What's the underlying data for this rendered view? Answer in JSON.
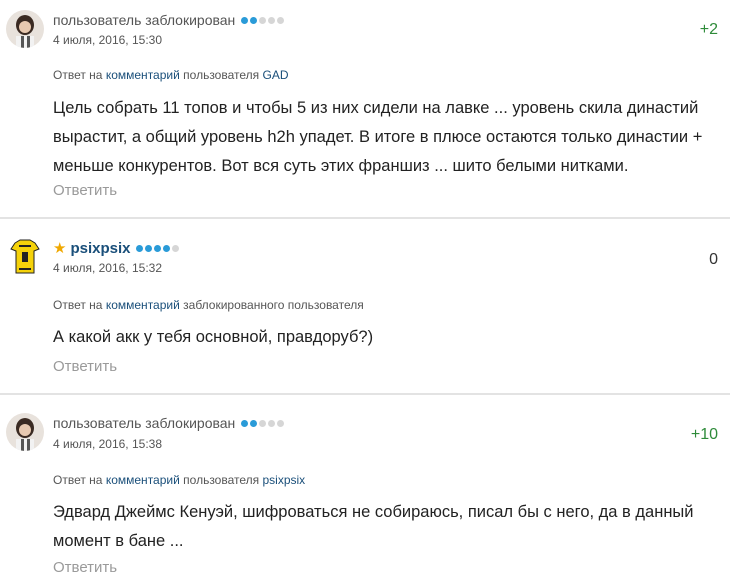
{
  "comments": [
    {
      "author": "пользователь заблокирован",
      "date": "4 июля, 2016, 15:30",
      "score": "+2",
      "reply_prefix": "Ответ на",
      "reply_link": "комментарий",
      "reply_mid": "пользователя",
      "reply_user": "GAD",
      "text_lines": [
        "Цель собрать 11 топов и чтобы 5 из них сидели на лавке ... уровень скила династий",
        "вырастит, а общий уровень h2h упадет. В итоге в плюсе остаются только династии +",
        "меньше конкурентов. Вот вся суть этих франшиз ... шито белыми нитками."
      ],
      "reply_label": "Ответить"
    },
    {
      "author": "psixpsix",
      "date": "4 июля, 2016, 15:32",
      "score": "0",
      "reply_prefix": "Ответ на",
      "reply_link": "комментарий",
      "reply_mid": "заблокированного пользователя",
      "reply_user": "",
      "text_lines": [
        "А какой акк у тебя основной, правдоруб?)"
      ],
      "reply_label": "Ответить"
    },
    {
      "author": "пользователь заблокирован",
      "date": "4 июля, 2016, 15:38",
      "score": "+10",
      "reply_prefix": "Ответ на",
      "reply_link": "комментарий",
      "reply_mid": "пользователя",
      "reply_user": "psixpsix",
      "text_lines": [
        "Эдвард Джеймс Кенуэй, шифроваться не собираюсь, писал бы с него, да в данный",
        "момент в бане ..."
      ],
      "reply_label": "Ответить"
    }
  ],
  "colors": {
    "accent": "#1a4f7a",
    "positive": "#2e8b3a",
    "rating_dot": "#2a9bd8",
    "star": "#f0a800"
  }
}
